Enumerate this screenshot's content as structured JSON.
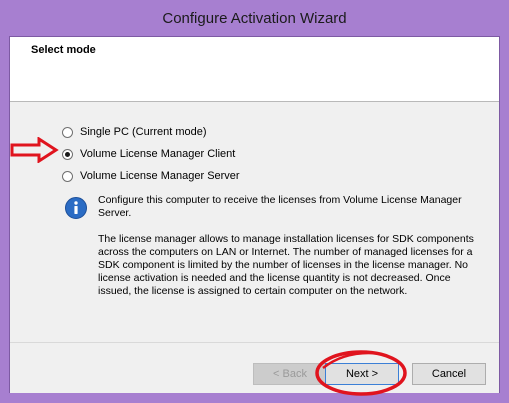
{
  "window": {
    "title": "Configure Activation Wizard"
  },
  "header": {
    "title": "Select mode"
  },
  "options": [
    {
      "label": "Single PC (Current mode)",
      "checked": false
    },
    {
      "label": "Volume License Manager Client",
      "checked": true
    },
    {
      "label": "Volume License Manager Server",
      "checked": false
    }
  ],
  "info": {
    "icon": "info-icon",
    "paragraph1": "Configure this computer to receive the licenses from Volume License Manager Server.",
    "paragraph2": "The license manager allows to manage installation licenses for SDK components across the computers on LAN or Internet. The number of managed licenses for a SDK component is limited by the number of licenses in the license manager. No license activation is needed and the license quantity is not decreased. Once issued, the license is assigned to certain computer on the network."
  },
  "buttons": {
    "back": "< Back",
    "next": "Next >",
    "cancel": "Cancel"
  },
  "colors": {
    "titlebar": "#a77fd0",
    "annotation": "#e0141e",
    "info_icon": "#2b6cc4"
  }
}
